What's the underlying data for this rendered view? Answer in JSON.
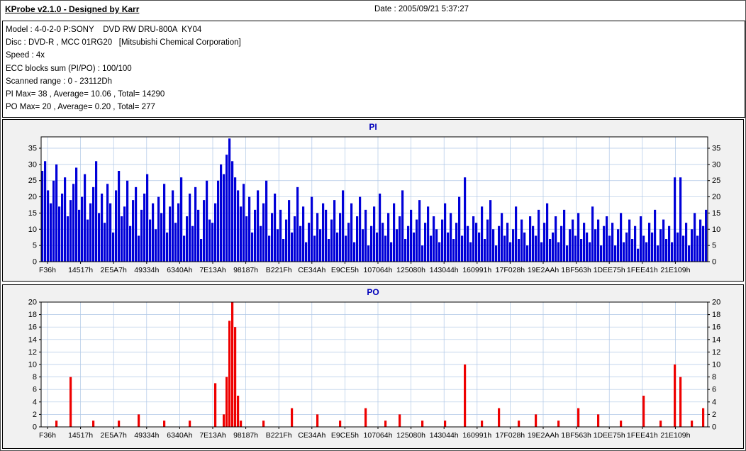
{
  "window": {
    "title": "KProbe v2.1.0 - Designed by Karr",
    "date": "Date : 2005/09/21 5:37:27"
  },
  "info": {
    "lines": [
      "Model : 4-0-2-0 P:SONY    DVD RW DRU-800A  KY04",
      "Disc : DVD-R , MCC 01RG20   [Mitsubishi Chemical Corporation]",
      "Speed : 4x",
      "ECC blocks sum (PI/PO) : 100/100",
      "Scanned range : 0 - 23112Dh",
      "PI Max= 38 , Average= 10.06 , Total= 14290",
      "PO Max= 20 , Average= 0.20 , Total= 277"
    ]
  },
  "colors": {
    "pi_series": "#0000d8",
    "po_series": "#ee0000",
    "chart_title": "#0000bb",
    "grid": "#afc7e6",
    "panel_bg": "#f1f1f1",
    "plot_bg": "#ffffff"
  },
  "chart_data": [
    {
      "type": "bar",
      "title": "PI",
      "xlabel": "",
      "ylabel": "",
      "series_color": "#0000d8",
      "ymax": 38.5,
      "ylim": [
        0,
        38.5
      ],
      "yticks": [
        0,
        5,
        10,
        15,
        20,
        25,
        30,
        35
      ],
      "grid": "on",
      "legend": "none",
      "xlabels": [
        "F36h",
        "14517h",
        "2E5A7h",
        "49334h",
        "6340Ah",
        "7E13Ah",
        "98187h",
        "B221Fh",
        "CE34Ah",
        "E9CE5h",
        "107064h",
        "125080h",
        "143044h",
        "160991h",
        "17F028h",
        "19E2AAh",
        "1BF563h",
        "1DEE75h",
        "1FEE41h",
        "21E109h"
      ],
      "values": [
        28,
        31,
        22,
        18,
        25,
        30,
        17,
        21,
        26,
        14,
        19,
        24,
        29,
        16,
        20,
        27,
        13,
        18,
        23,
        31,
        15,
        21,
        12,
        24,
        18,
        9,
        22,
        28,
        14,
        17,
        25,
        11,
        19,
        23,
        8,
        16,
        21,
        27,
        13,
        18,
        10,
        20,
        15,
        24,
        9,
        17,
        22,
        12,
        18,
        26,
        8,
        14,
        21,
        11,
        23,
        16,
        7,
        19,
        25,
        13,
        12,
        18,
        25,
        30,
        27,
        33,
        38,
        31,
        26,
        22,
        17,
        24,
        14,
        20,
        9,
        16,
        22,
        11,
        18,
        25,
        8,
        15,
        21,
        10,
        16,
        7,
        13,
        19,
        9,
        14,
        23,
        11,
        17,
        6,
        12,
        20,
        8,
        15,
        10,
        18,
        16,
        7,
        13,
        19,
        9,
        15,
        22,
        8,
        12,
        18,
        6,
        14,
        20,
        10,
        16,
        5,
        11,
        17,
        9,
        21,
        12,
        8,
        15,
        6,
        18,
        10,
        14,
        22,
        7,
        11,
        16,
        9,
        13,
        19,
        5,
        12,
        17,
        8,
        14,
        10,
        6,
        13,
        18,
        9,
        15,
        7,
        12,
        20,
        8,
        26,
        11,
        6,
        14,
        12,
        9,
        17,
        7,
        13,
        19,
        10,
        5,
        11,
        15,
        8,
        12,
        6,
        10,
        17,
        7,
        13,
        9,
        5,
        14,
        11,
        8,
        16,
        6,
        12,
        18,
        7,
        9,
        14,
        6,
        11,
        16,
        5,
        10,
        13,
        8,
        15,
        7,
        12,
        9,
        6,
        17,
        10,
        13,
        5,
        11,
        14,
        8,
        12,
        5,
        10,
        15,
        6,
        9,
        13,
        7,
        11,
        4,
        14,
        8,
        6,
        12,
        9,
        16,
        5,
        10,
        13,
        7,
        11,
        6,
        26,
        9,
        26,
        8,
        12,
        5,
        10,
        15,
        8,
        13,
        11,
        16
      ]
    },
    {
      "type": "bar",
      "title": "PO",
      "xlabel": "",
      "ylabel": "",
      "series_color": "#ee0000",
      "ymax": 20,
      "ylim": [
        0,
        20
      ],
      "yticks": [
        0,
        2,
        4,
        6,
        8,
        10,
        12,
        14,
        16,
        18,
        20
      ],
      "grid": "on",
      "legend": "none",
      "n": 235,
      "xlabels": [
        "F36h",
        "14517h",
        "2E5A7h",
        "49334h",
        "6340Ah",
        "7E13Ah",
        "98187h",
        "B221Fh",
        "CE34Ah",
        "E9CE5h",
        "107064h",
        "125080h",
        "143044h",
        "160991h",
        "17F028h",
        "19E2AAh",
        "1BF563h",
        "1DEE75h",
        "1FEE41h",
        "21E109h"
      ],
      "points": [
        {
          "i": 5,
          "v": 1
        },
        {
          "i": 10,
          "v": 8
        },
        {
          "i": 18,
          "v": 1
        },
        {
          "i": 27,
          "v": 1
        },
        {
          "i": 34,
          "v": 2
        },
        {
          "i": 43,
          "v": 1
        },
        {
          "i": 52,
          "v": 1
        },
        {
          "i": 61,
          "v": 7
        },
        {
          "i": 64,
          "v": 2
        },
        {
          "i": 65,
          "v": 8
        },
        {
          "i": 66,
          "v": 17
        },
        {
          "i": 67,
          "v": 20
        },
        {
          "i": 68,
          "v": 16
        },
        {
          "i": 69,
          "v": 5
        },
        {
          "i": 70,
          "v": 1
        },
        {
          "i": 78,
          "v": 1
        },
        {
          "i": 88,
          "v": 3
        },
        {
          "i": 97,
          "v": 2
        },
        {
          "i": 105,
          "v": 1
        },
        {
          "i": 114,
          "v": 3
        },
        {
          "i": 121,
          "v": 1
        },
        {
          "i": 126,
          "v": 2
        },
        {
          "i": 134,
          "v": 1
        },
        {
          "i": 142,
          "v": 1
        },
        {
          "i": 149,
          "v": 10
        },
        {
          "i": 155,
          "v": 1
        },
        {
          "i": 161,
          "v": 3
        },
        {
          "i": 168,
          "v": 1
        },
        {
          "i": 174,
          "v": 2
        },
        {
          "i": 182,
          "v": 1
        },
        {
          "i": 189,
          "v": 3
        },
        {
          "i": 196,
          "v": 2
        },
        {
          "i": 204,
          "v": 1
        },
        {
          "i": 212,
          "v": 5
        },
        {
          "i": 218,
          "v": 1
        },
        {
          "i": 223,
          "v": 10
        },
        {
          "i": 225,
          "v": 8
        },
        {
          "i": 229,
          "v": 1
        },
        {
          "i": 233,
          "v": 3
        }
      ]
    }
  ]
}
